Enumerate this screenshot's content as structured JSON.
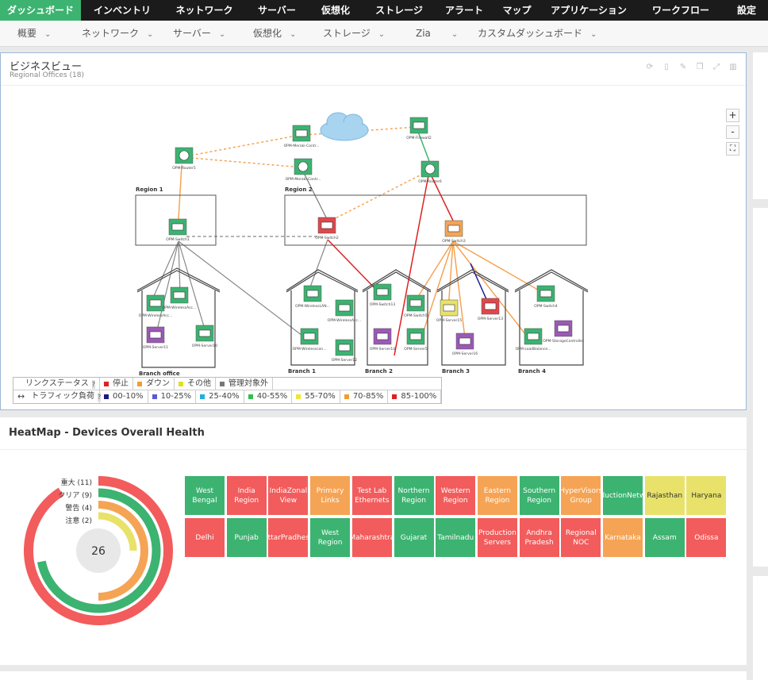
{
  "topnav": [
    "ダッシュボード",
    "インベントリ",
    "ネットワーク",
    "サーバー",
    "仮想化",
    "ストレージ",
    "アラート",
    "マップ",
    "アプリケーション",
    "ワークフロー",
    "設定"
  ],
  "subnav": [
    "概要",
    "ネットワーク",
    "サーバー",
    "仮想化",
    "ストレージ",
    "Zia",
    "カスタムダッシュボード"
  ],
  "business_view": {
    "title": "ビジネスビュー",
    "subtitle": "Regional Offices (18)",
    "zoom_in": "+",
    "zoom_out": "-",
    "fit": "⛶",
    "regions": [
      "Region 1",
      "Region 2"
    ],
    "branches": [
      "Branch office",
      "Branch 1",
      "Branch 2",
      "Branch 3",
      "Branch 4"
    ],
    "devices": [
      "OPM-Router5",
      "OPM-Meraki-Contr...",
      "OPM-Meraki-Contr...",
      "OPM-Firewall2",
      "OPM-Router6",
      "OPM-Switch1",
      "OPM-Switch2",
      "OPM-Switch3",
      "OPM-WirelessAcc...",
      "OPM-WirelessAcc...",
      "OPM-Server11",
      "OPM-Server10",
      "OPM-WirelessLAN...",
      "OPM-WirelessAcc...",
      "OPM-Wirelesscon...",
      "OPM-Server12",
      "OPM-Switch13",
      "OPM-Switch5",
      "OPM-Server14",
      "OPM-Server5",
      "OPM-Server15",
      "OPM-Server13",
      "OPM-Server16",
      "OPM-Switch4",
      "OPM-LoadBalance...",
      "OPM-StorageController"
    ]
  },
  "legend": {
    "link_status": "リンクステータス",
    "traffic": "トラフィック負荷",
    "help": "?",
    "status_items": [
      {
        "label": "停止",
        "color": "#e02020"
      },
      {
        "label": "ダウン",
        "color": "#f39c34"
      },
      {
        "label": "その他",
        "color": "#e0e020"
      },
      {
        "label": "管理対象外",
        "color": "#777777"
      }
    ],
    "traffic_items": [
      {
        "label": "00-10%",
        "color": "#1b1b7a"
      },
      {
        "label": "10-25%",
        "color": "#5a5ad6"
      },
      {
        "label": "25-40%",
        "color": "#1fb0e0"
      },
      {
        "label": "40-55%",
        "color": "#33c04a"
      },
      {
        "label": "55-70%",
        "color": "#e8e838"
      },
      {
        "label": "70-85%",
        "color": "#f39c34"
      },
      {
        "label": "85-100%",
        "color": "#e02020"
      }
    ]
  },
  "heatmap": {
    "title": "HeatMap - Devices Overall Health",
    "total": "26",
    "donut": [
      {
        "label": "重大 (11)",
        "color": "#f25c5c",
        "fraction": 0.91
      },
      {
        "label": "クリア (9)",
        "color": "#3cb371",
        "fraction": 0.72
      },
      {
        "label": "警告 (4)",
        "color": "#f5a455",
        "fraction": 0.5
      },
      {
        "label": "注意 (2)",
        "color": "#e8e26a",
        "fraction": 0.25
      }
    ],
    "colors": {
      "green": "#3cb371",
      "red": "#f25c5c",
      "orange": "#f5a455",
      "yellow": "#e8e26a"
    },
    "tiles_row1": [
      {
        "label": "West Bengal",
        "status": "green"
      },
      {
        "label": "India Region",
        "status": "red"
      },
      {
        "label": "IndiaZonal View",
        "status": "red"
      },
      {
        "label": "Primary Links",
        "status": "orange"
      },
      {
        "label": "Test Lab Ethernets",
        "status": "red"
      },
      {
        "label": "Northern Region",
        "status": "green"
      },
      {
        "label": "Western Region",
        "status": "red"
      },
      {
        "label": "Eastern Region",
        "status": "orange"
      },
      {
        "label": "Southern Region",
        "status": "green"
      },
      {
        "label": "HyperVisors Group",
        "status": "orange"
      },
      {
        "label": "ProductionNetwork",
        "status": "green"
      },
      {
        "label": "Rajasthan",
        "status": "yellow"
      },
      {
        "label": "Haryana",
        "status": "yellow"
      }
    ],
    "tiles_row2": [
      {
        "label": "Delhi",
        "status": "red"
      },
      {
        "label": "Punjab",
        "status": "green"
      },
      {
        "label": "UttarPradhesh",
        "status": "red"
      },
      {
        "label": "West Region",
        "status": "green"
      },
      {
        "label": "Maharashtra",
        "status": "red"
      },
      {
        "label": "Gujarat",
        "status": "green"
      },
      {
        "label": "Tamilnadu",
        "status": "green"
      },
      {
        "label": "Production Servers",
        "status": "red"
      },
      {
        "label": "Andhra Pradesh",
        "status": "red"
      },
      {
        "label": "Regional NOC",
        "status": "red"
      },
      {
        "label": "Karnataka",
        "status": "orange"
      },
      {
        "label": "Assam",
        "status": "green"
      },
      {
        "label": "Odissa",
        "status": "red"
      }
    ]
  }
}
